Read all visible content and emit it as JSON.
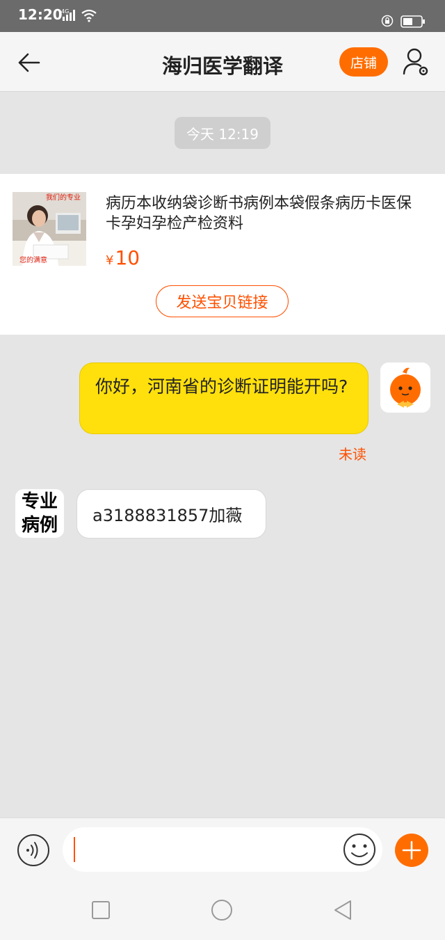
{
  "status_bar": {
    "time": "12:20",
    "network": "4G"
  },
  "header": {
    "title": "海归医学翻译",
    "shop_label": "店铺"
  },
  "chat": {
    "timestamp": "今天  12:19",
    "product": {
      "title": "病历本收纳袋诊断书病例本袋假条病历卡医保卡孕妇孕检产检资料",
      "currency": "¥",
      "price": "10",
      "send_link_label": "发送宝贝链接",
      "thumb_caption_top": "我们的专业",
      "thumb_caption_bottom": "您的满意"
    },
    "my_message": {
      "text": "你好，河南省的诊断证明能开吗?",
      "status": "未读"
    },
    "other_message": {
      "avatar_line1": "专业",
      "avatar_line2": "病例",
      "text": "a3188831857加薇"
    }
  },
  "input": {
    "placeholder": ""
  },
  "colors": {
    "accent": "#ff6d00",
    "bubble_mine": "#ffe00d",
    "background": "#e5e5e5"
  }
}
